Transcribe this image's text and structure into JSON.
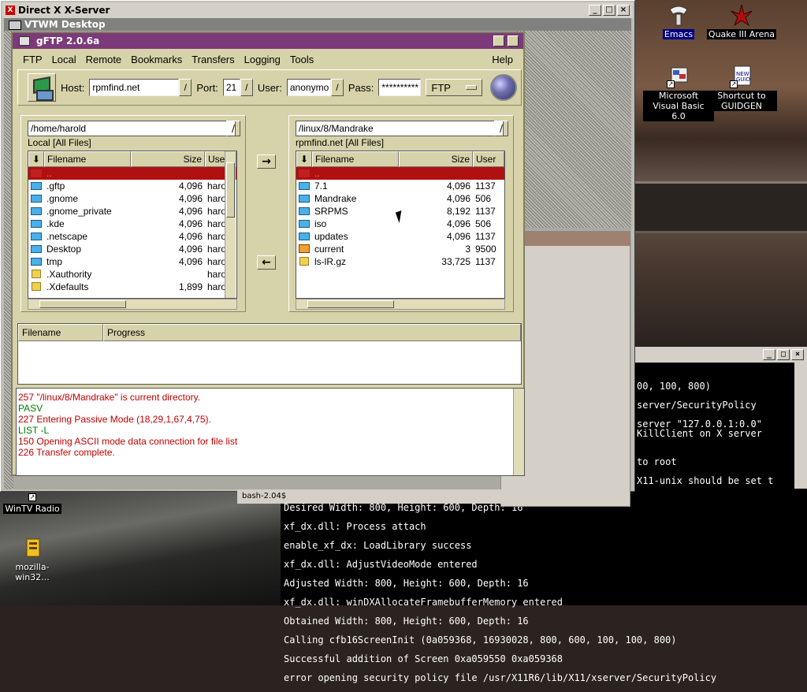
{
  "desktop": {
    "icons": [
      {
        "id": "emacs",
        "label": "Emacs"
      },
      {
        "id": "quake",
        "label": "Quake III Arena"
      },
      {
        "id": "msvb",
        "label": "Microsoft Visual Basic 6.0"
      },
      {
        "id": "guidgen",
        "label": "Shortcut to GUIDGEN"
      },
      {
        "id": "wintv",
        "label": "WinTV Radio"
      },
      {
        "id": "mozilla",
        "label": "mozilla-win32..."
      }
    ]
  },
  "xserver": {
    "title": "Direct X X-Server",
    "vtwm_title": "VTWM Desktop"
  },
  "gftp": {
    "title": "gFTP 2.0.6a",
    "menu": [
      "FTP",
      "Local",
      "Remote",
      "Bookmarks",
      "Transfers",
      "Logging",
      "Tools",
      "Help"
    ],
    "toolbar": {
      "host_label": "Host:",
      "host": "rpmfind.net",
      "port_label": "Port:",
      "port": "21",
      "user_label": "User:",
      "user": "anonymo",
      "pass_label": "Pass:",
      "pass": "**********",
      "protocol": "FTP"
    },
    "local": {
      "path": "/home/harold",
      "label": "Local [All Files]",
      "headers": [
        "Filename",
        "Size",
        "User"
      ],
      "rows": [
        {
          "icon": "up",
          "name": "..",
          "size": "",
          "user": ""
        },
        {
          "icon": "folder",
          "name": ".gftp",
          "size": "4,096",
          "user": "harold"
        },
        {
          "icon": "folder",
          "name": ".gnome",
          "size": "4,096",
          "user": "harold"
        },
        {
          "icon": "folder",
          "name": ".gnome_private",
          "size": "4,096",
          "user": "harold"
        },
        {
          "icon": "folder",
          "name": ".kde",
          "size": "4,096",
          "user": "harold"
        },
        {
          "icon": "folder",
          "name": ".netscape",
          "size": "4,096",
          "user": "harold"
        },
        {
          "icon": "folder",
          "name": "Desktop",
          "size": "4,096",
          "user": "harold"
        },
        {
          "icon": "folder",
          "name": "tmp",
          "size": "4,096",
          "user": "harold"
        },
        {
          "icon": "file",
          "name": ".Xauthority",
          "size": "",
          "user": "harold"
        },
        {
          "icon": "file",
          "name": ".Xdefaults",
          "size": "1,899",
          "user": "harold"
        }
      ]
    },
    "remote": {
      "path": "/linux/8/Mandrake",
      "label": "rpmfind.net [All Files]",
      "headers": [
        "Filename",
        "Size",
        "User"
      ],
      "rows": [
        {
          "icon": "up",
          "name": "..",
          "size": "",
          "user": ""
        },
        {
          "icon": "folder",
          "name": "7.1",
          "size": "4,096",
          "user": "1137"
        },
        {
          "icon": "folder",
          "name": "Mandrake",
          "size": "4,096",
          "user": "506"
        },
        {
          "icon": "folder",
          "name": "SRPMS",
          "size": "8,192",
          "user": "1137"
        },
        {
          "icon": "folder",
          "name": "iso",
          "size": "4,096",
          "user": "506"
        },
        {
          "icon": "folder",
          "name": "updates",
          "size": "4,096",
          "user": "1137"
        },
        {
          "icon": "link",
          "name": "current",
          "size": "3",
          "user": "9500"
        },
        {
          "icon": "file",
          "name": "ls-lR.gz",
          "size": "33,725",
          "user": "1137"
        }
      ]
    },
    "arrows": {
      "right": "→",
      "left": "←"
    },
    "queue_headers": [
      "Filename",
      "Progress"
    ],
    "log": [
      {
        "c": "red",
        "t": "257 \"/linux/8/Mandrake\" is current directory."
      },
      {
        "c": "grn",
        "t": "PASV"
      },
      {
        "c": "red",
        "t": "227 Entering Passive Mode (18,29,1,67,4,75)."
      },
      {
        "c": "grn",
        "t": "LIST -L"
      },
      {
        "c": "red",
        "t": "150 Opening ASCII mode data connection for file list"
      },
      {
        "c": "red",
        "t": "226 Transfer complete."
      }
    ]
  },
  "term2": {
    "lines": [
      "00, 100, 800)",
      "server/SecurityPolicy",
      "server \"127.0.0.1:0.0\"",
      "KillClient on X server",
      "to root",
      "X11-unix should be set t"
    ]
  },
  "terminal": {
    "lines": [
      "Desired Width: 800, Height: 600, Depth: 16",
      "xf_dx.dll: Process attach",
      "enable_xf_dx: LoadLibrary success",
      "xf_dx.dll: AdjustVideoMode entered",
      "Adjusted Width: 800, Height: 600, Depth: 16",
      "xf_dx.dll: winDXAllocateFramebufferMemory entered",
      "Obtained Width: 800, Height: 600, Depth: 16",
      "Calling cfb16ScreenInit (0a059368, 16930028, 800, 600, 100, 100, 800)",
      "Successful addition of Screen 0xa059550 0xa059368",
      "error opening security policy file /usr/X11R6/lib/X11/xserver/SecurityPolicy"
    ]
  },
  "behind_window": {
    "text": "bash-2.04$"
  }
}
